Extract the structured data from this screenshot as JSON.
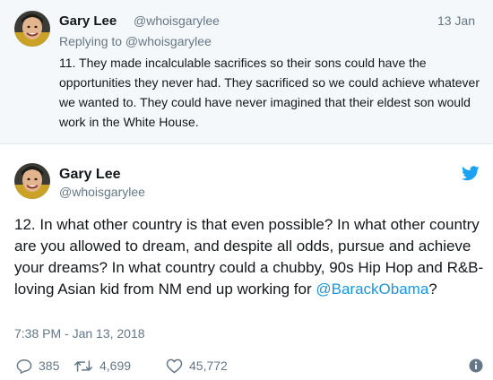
{
  "reply_tweet": {
    "name": "Gary Lee",
    "handle": "@whoisgarylee",
    "date": "13 Jan",
    "replying_to": "Replying to @whoisgarylee",
    "text": "11. They made incalculable sacrifices so their sons could have the opportunities they never had. They sacrificed so we could achieve whatever we wanted to. They could have never imagined that their eldest son would work in the White House."
  },
  "main_tweet": {
    "name": "Gary Lee",
    "handle": "@whoisgarylee",
    "text": "12. In what other country is that even possible? In what other country are you allowed to dream, and despite all odds, pursue and achieve your dreams? In what country could a chubby, 90s Hip Hop and R&B-loving Asian kid from NM end up working for ",
    "mention": "@BarackObama",
    "text_end": "?",
    "timestamp": "7:38 PM - Jan 13, 2018",
    "replies": "385",
    "retweets": "4,699",
    "likes": "45,772"
  },
  "icons": {
    "brand": "twitter-bird-icon",
    "reply": "reply-bubble-icon",
    "retweet": "retweet-icon",
    "like": "heart-icon",
    "info": "info-icon"
  },
  "colors": {
    "brand_blue": "#1da1f2",
    "link": "#1b95e0",
    "muted": "#657786",
    "reply_background": "#f5f8fa"
  }
}
